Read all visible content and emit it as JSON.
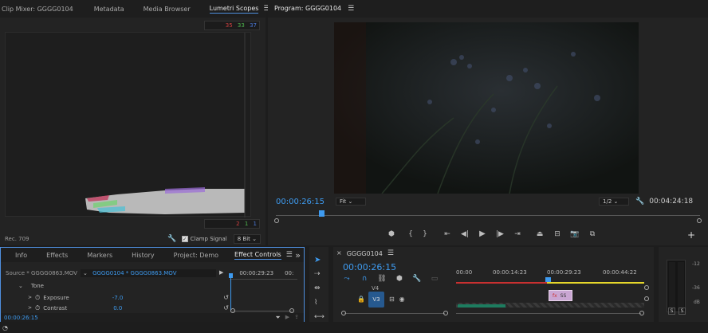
{
  "top_left_panel": {
    "tabs": [
      "Clip Mixer: GGGG0104",
      "Metadata",
      "Media Browser",
      "Lumetri Scopes"
    ],
    "active_tab": "Lumetri Scopes",
    "overflow": "»",
    "scope_values": {
      "r": "35",
      "g": "33",
      "b": "37"
    },
    "scope_values_bottom": {
      "r": "2",
      "g": "1",
      "b": "1"
    },
    "scope_label": "Rec. 709",
    "clamp_signal_label": "Clamp Signal",
    "bit_depth": "8 Bit"
  },
  "program_monitor": {
    "title": "Program: GGGG0104",
    "timecode": "00:00:26:15",
    "fit": "Fit",
    "resolution": "1/2",
    "duration": "00:04:24:18"
  },
  "effect_controls": {
    "tabs": [
      "Info",
      "Effects",
      "Markers",
      "History",
      "Project: Demo",
      "Effect Controls"
    ],
    "active_tab": "Effect Controls",
    "source": "Source * GGGG0863.MOV",
    "clip": "GGGG0104 * GGGG0863.MOV",
    "timecode_ruler": "00:00:29:23",
    "timecode_ruler2": "00:",
    "section": "Tone",
    "rows": [
      {
        "label": "Exposure",
        "value": "-7.0"
      },
      {
        "label": "Contrast",
        "value": "0.0"
      }
    ],
    "current_time": "00:00:26:15"
  },
  "timeline": {
    "sequence": "GGGG0104",
    "timecode": "00:00:26:15",
    "ruler": [
      "00:00",
      "00:00:14:23",
      "00:00:29:23",
      "00:00:44:22"
    ],
    "tracks": [
      "V4",
      "V3"
    ],
    "clip_label_fx": "fx",
    "clip_label": "SS"
  },
  "audio_meter": {
    "ticks": [
      "-12",
      "-36",
      "dB"
    ],
    "solo": [
      "S",
      "S"
    ]
  },
  "colors": {
    "accent_blue": "#3e9bf0",
    "highlight_border": "#4f8fdf",
    "yellow_bar": "#e5d62b",
    "track_blue": "#26598f",
    "clip_pink": "#caa6d3"
  }
}
